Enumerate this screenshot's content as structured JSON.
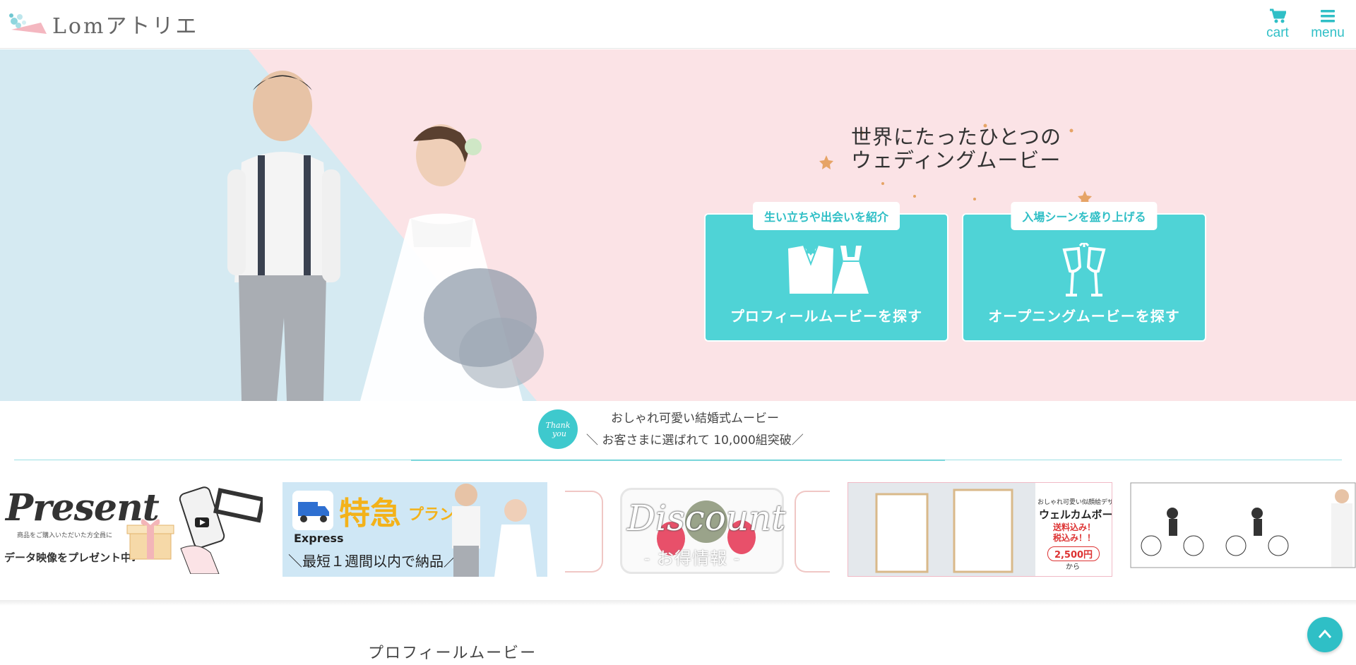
{
  "header": {
    "logo_text": "Lomアトリエ",
    "cart_label": "cart",
    "menu_label": "menu"
  },
  "hero": {
    "tagline_line1": "世界にたったひとつの",
    "tagline_line2": "ウェディングムービー",
    "cards": [
      {
        "tag": "生い立ちや出会いを紹介",
        "title": "プロフィールムービーを探す",
        "icon": "tuxedo-dress-icon"
      },
      {
        "tag": "入場シーンを盛り上げる",
        "title": "オープニングムービーを探す",
        "icon": "champagne-toast-icon"
      }
    ]
  },
  "thanks": {
    "badge_text": "Thank you",
    "line1": "おしゃれ可愛い結婚式ムービー",
    "line2": "＼ お客さまに選ばれて 10,000組突破／"
  },
  "banners": {
    "present": {
      "title": "Present",
      "small": "商品をご購入いただいた方全員に",
      "main": "データ映像をプレゼント中♪"
    },
    "express": {
      "toku": "特急",
      "plan": "プラン",
      "label": "Express",
      "note": "＼最短１週間以内で納品／"
    },
    "discount": {
      "word": "Discount",
      "sub": "- お得情報 -"
    },
    "welcome": {
      "small": "おしゃれ可愛い似顔絵デザイン",
      "title": "ウェルカムボード",
      "shipping": "送料込み！\n税込み！！",
      "price": "2,500円",
      "from": "から"
    }
  },
  "section": {
    "title": "プロフィールムービー"
  },
  "colors": {
    "accent": "#2fbfc6",
    "card": "#4fd3d6",
    "hero_pink": "#fbe3e6",
    "hero_blue": "#d5eaf2"
  }
}
